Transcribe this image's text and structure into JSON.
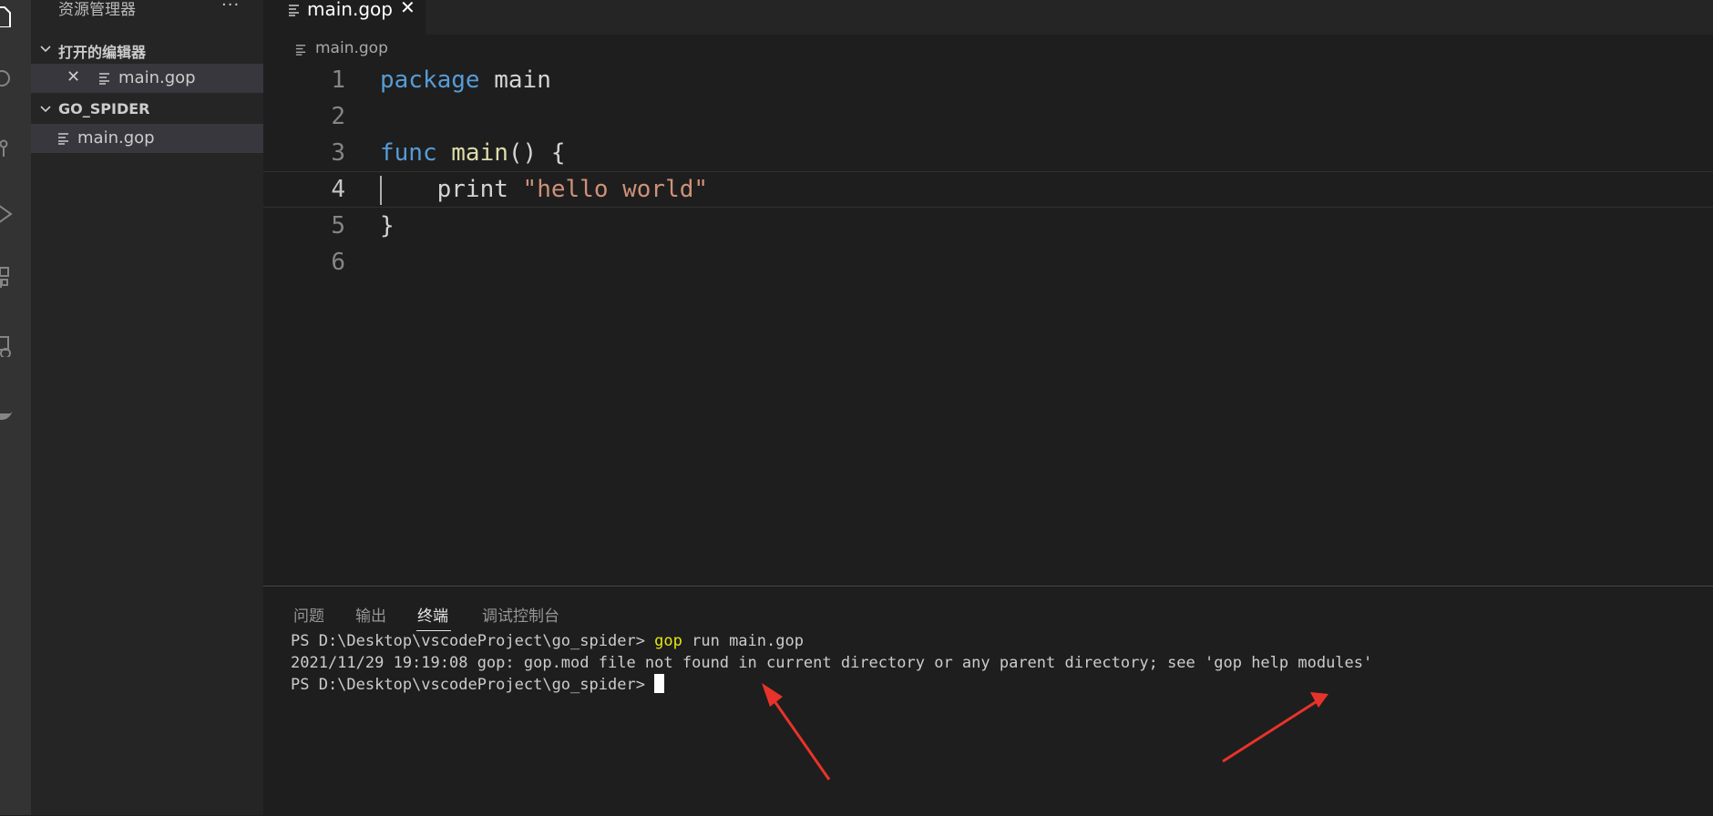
{
  "sidebar": {
    "title": "资源管理器",
    "more": "···",
    "open_editors": {
      "header": "打开的编辑器",
      "items": [
        {
          "close": "✕",
          "label": "main.gop"
        }
      ]
    },
    "folder": {
      "header": "GO_SPIDER",
      "items": [
        {
          "label": "main.gop"
        }
      ]
    }
  },
  "tab": {
    "label": "main.gop",
    "close": "✕"
  },
  "breadcrumb": {
    "file": "main.gop"
  },
  "editor": {
    "current_line": 4,
    "lines": [
      {
        "num": "1",
        "tokens": [
          {
            "t": "package",
            "c": "kw"
          },
          {
            "t": " main",
            "c": ""
          }
        ]
      },
      {
        "num": "2",
        "tokens": []
      },
      {
        "num": "3",
        "tokens": [
          {
            "t": "func",
            "c": "kw"
          },
          {
            "t": " ",
            "c": ""
          },
          {
            "t": "main",
            "c": "fn"
          },
          {
            "t": "() {",
            "c": ""
          }
        ]
      },
      {
        "num": "4",
        "tokens": [
          {
            "t": "    print ",
            "c": ""
          },
          {
            "t": "\"hello world\"",
            "c": "str"
          }
        ]
      },
      {
        "num": "5",
        "tokens": [
          {
            "t": "}",
            "c": ""
          }
        ]
      },
      {
        "num": "6",
        "tokens": []
      }
    ]
  },
  "panel": {
    "tabs": [
      "问题",
      "输出",
      "终端",
      "调试控制台"
    ],
    "active_tab": "终端",
    "terminal": {
      "line1_prompt": "PS D:\\Desktop\\vscodeProject\\go_spider> ",
      "line1_cmd": "gop",
      "line1_rest": " run main.gop",
      "line2": "2021/11/29 19:19:08 gop: gop.mod file not found in current directory or any parent directory; see 'gop help modules'",
      "line3_prompt": "PS D:\\Desktop\\vscodeProject\\go_spider> "
    }
  },
  "colors": {
    "keyword": "#569cd6",
    "function": "#dcdcaa",
    "string": "#ce9178",
    "terminal_command": "#e5e510",
    "annotation_arrow": "#e8332a"
  },
  "icons": [
    "explorer-icon",
    "search-icon",
    "source-control-icon",
    "run-debug-icon",
    "extensions-icon",
    "remote-explorer-icon",
    "docker-icon",
    "chevron-down-icon",
    "close-icon",
    "file-lines-icon"
  ]
}
